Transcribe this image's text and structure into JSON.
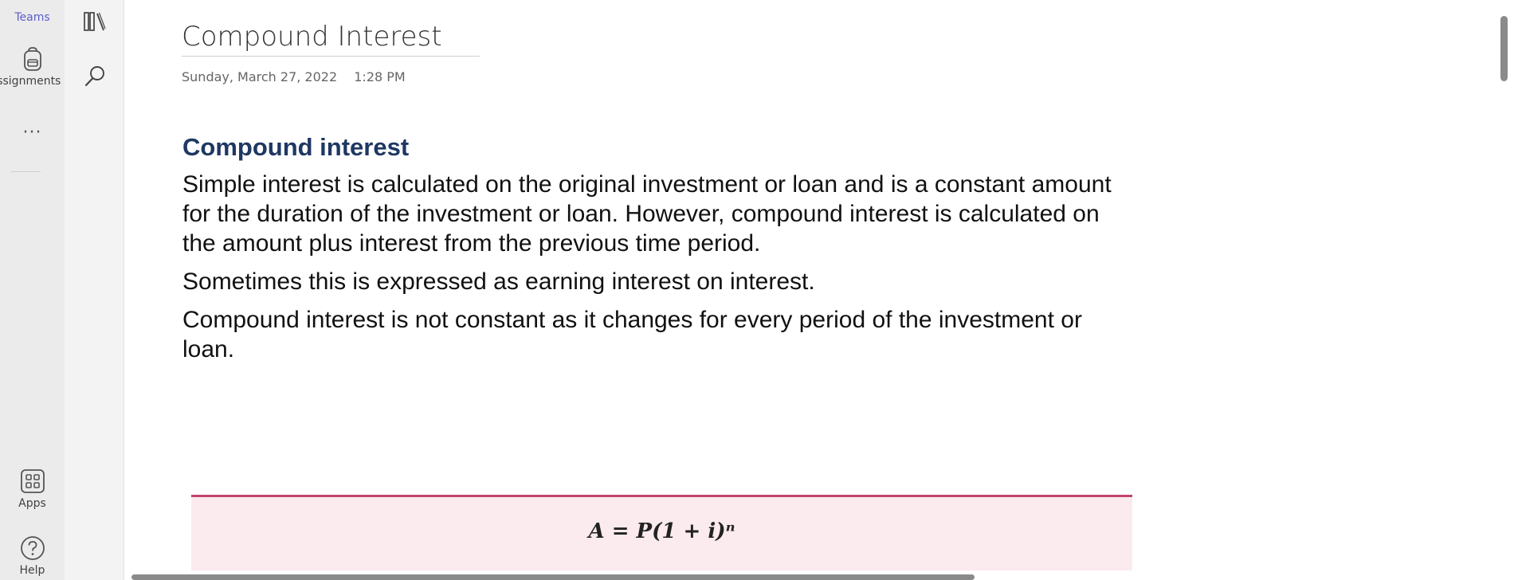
{
  "app_rail": {
    "teams_label": "Teams",
    "assignments_label": "Assignments",
    "more_label": "···",
    "apps_label": "Apps",
    "help_label": "Help",
    "icons": [
      "teams-icon",
      "backpack-icon",
      "more-icon",
      "apps-icon",
      "help-icon"
    ]
  },
  "nav": {
    "icons": [
      "library-icon",
      "search-icon"
    ]
  },
  "page": {
    "title": "Compound Interest",
    "date": "Sunday, March 27, 2022",
    "time": "1:28 PM"
  },
  "content": {
    "heading": "Compound interest",
    "paragraphs": [
      "Simple interest is calculated on the original investment or loan and is a constant amount for the duration of the investment or loan. However, compound interest is calculated on the amount plus interest from the previous time period.",
      "Sometimes this is expressed as earning interest on interest.",
      "Compound interest is not constant as it changes for every period of the investment or loan."
    ],
    "formula": "A = P(1 + i)ⁿ"
  },
  "colors": {
    "heading": "#1f3763",
    "accent": "#5b5fc7",
    "formula_border": "#c2446a",
    "formula_bg": "#fbeaee"
  }
}
